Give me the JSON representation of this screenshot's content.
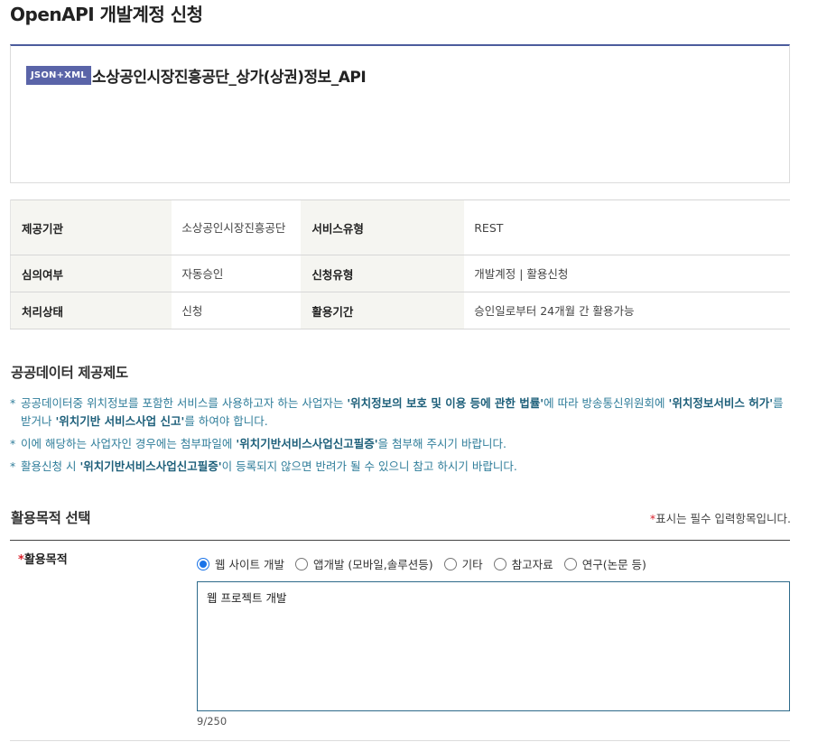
{
  "page": {
    "title": "OpenAPI 개발계정 신청"
  },
  "api": {
    "badge": "JSON+XML",
    "name": "소상공인시장진흥공단_상가(상권)정보_API"
  },
  "info": {
    "rows": [
      [
        {
          "label": "제공기관",
          "value": "소상공인시장진흥공단"
        },
        {
          "label": "서비스유형",
          "value": "REST"
        }
      ],
      [
        {
          "label": "심의여부",
          "value": "자동승인"
        },
        {
          "label": "신청유형",
          "value": "개발계정 | 활용신청"
        }
      ],
      [
        {
          "label": "처리상태",
          "value": "신청"
        },
        {
          "label": "활용기간",
          "value": "승인일로부터 24개월 간 활용가능"
        }
      ]
    ]
  },
  "policy": {
    "title": "공공데이터 제공제도",
    "notices": [
      {
        "p1": "공공데이터중 위치정보를 포함한 서비스를 사용하고자 하는 사업자는 ",
        "b1": "'위치정보의 보호 및 이용 등에 관한 법률'",
        "p2": "에 따라 방송통신위원회에 ",
        "b2": "'위치정보서비스 허가'",
        "p3": "를 받거나 ",
        "b3": "'위치기반 서비스사업 신고'",
        "p4": "를 하여야 합니다."
      },
      {
        "p1": "이에 해당하는 사업자인 경우에는 첨부파일에 ",
        "b1": "'위치기반서비스사업신고필증'",
        "p2": "을 첨부해 주시기 바랍니다."
      },
      {
        "p1": "활용신청 시 ",
        "b1": "'위치기반서비스사업신고필증'",
        "p2": "이 등록되지 않으면 반려가 될 수 있으니 참고 하시기 바랍니다."
      }
    ]
  },
  "purpose": {
    "title": "활용목적 선택",
    "required_mark": "*",
    "required_note": "표시는 필수 입력항목입니다.",
    "field_label": "활용목적",
    "options": [
      {
        "label": "웹 사이트 개발",
        "selected": true
      },
      {
        "label": "앱개발 (모바일,솔루션등)",
        "selected": false
      },
      {
        "label": "기타",
        "selected": false
      },
      {
        "label": "참고자료",
        "selected": false
      },
      {
        "label": "연구(논문 등)",
        "selected": false
      }
    ],
    "text_value": "웹 프로젝트 개발",
    "counter": "9/250"
  },
  "colors": {
    "accent": "#4b5c9c",
    "badge": "#5a64a8",
    "notice_text": "#2f7d9a",
    "required": "#d9232d",
    "radio_selected": "#1a73e8"
  }
}
